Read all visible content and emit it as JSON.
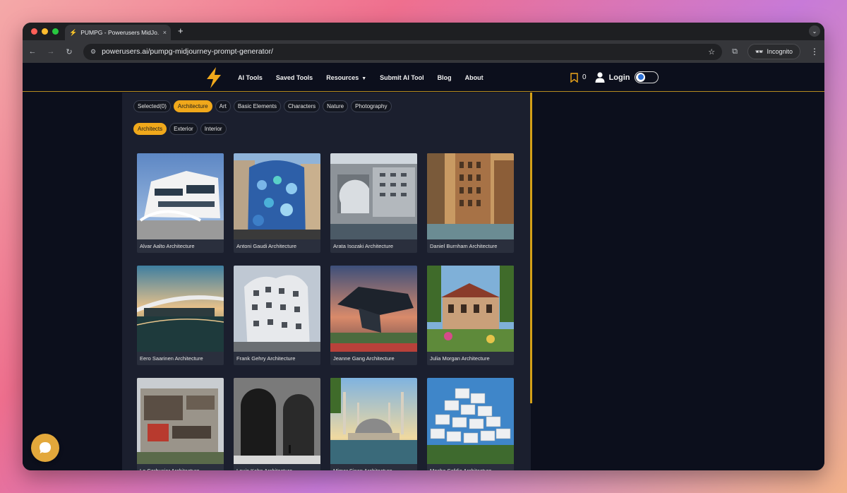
{
  "browser": {
    "tab_title": "PUMPG - Powerusers MidJo...",
    "tab_close": "×",
    "new_tab": "+",
    "url": "powerusers.ai/pumpg-midjourney-prompt-generator/",
    "incognito_label": "Incognito"
  },
  "site": {
    "nav": [
      {
        "label": "AI Tools"
      },
      {
        "label": "Saved Tools"
      },
      {
        "label": "Resources"
      },
      {
        "label": "Submit AI Tool"
      },
      {
        "label": "Blog"
      },
      {
        "label": "About"
      }
    ],
    "bookmark_count": "0",
    "login_label": "Login",
    "brand_color": "#f0a81b"
  },
  "filters": {
    "categories": [
      {
        "label": "Selected(0)",
        "active": false
      },
      {
        "label": "Architecture",
        "active": true
      },
      {
        "label": "Art",
        "active": false
      },
      {
        "label": "Basic Elements",
        "active": false
      },
      {
        "label": "Characters",
        "active": false
      },
      {
        "label": "Nature",
        "active": false
      },
      {
        "label": "Photography",
        "active": false
      }
    ],
    "subcategories": [
      {
        "label": "Architects",
        "active": true
      },
      {
        "label": "Exterior",
        "active": false
      },
      {
        "label": "Interior",
        "active": false
      }
    ]
  },
  "cards": [
    {
      "caption": "Alvar Aalto Architecture"
    },
    {
      "caption": "Antoni Gaudi Architecture"
    },
    {
      "caption": "Arata Isozaki Architecture"
    },
    {
      "caption": "Daniel Burnham Architecture"
    },
    {
      "caption": "Eero Saarinen Architecture"
    },
    {
      "caption": "Frank Gehry Architecture"
    },
    {
      "caption": "Jeanne Gang Architecture"
    },
    {
      "caption": "Julia Morgan Architecture"
    },
    {
      "caption": "Le Corbusier Architecture"
    },
    {
      "caption": "Louis Kahn Architecture"
    },
    {
      "caption": "Mimar Sinan Architecture"
    },
    {
      "caption": "Moshe Safdie Architecture"
    }
  ]
}
